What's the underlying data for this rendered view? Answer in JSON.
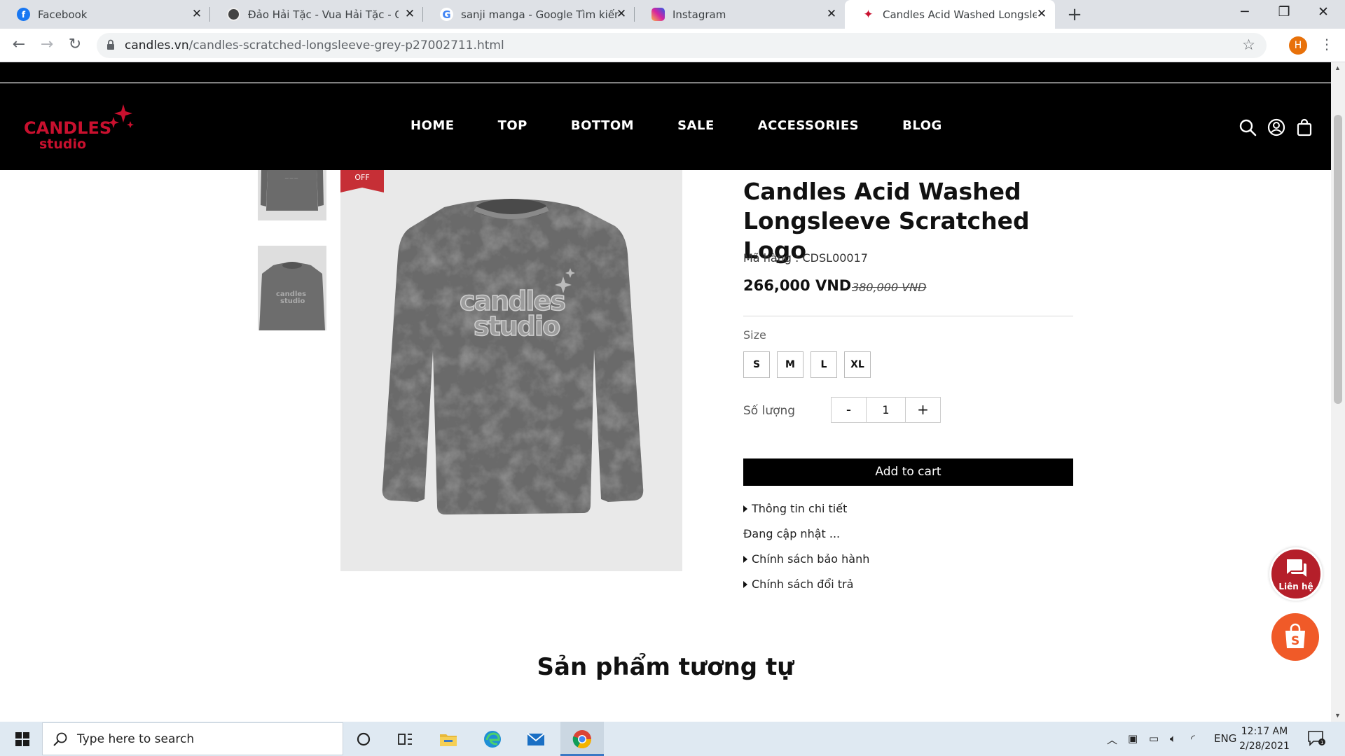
{
  "browser": {
    "tabs": [
      {
        "label": "Facebook",
        "icon": "facebook-icon",
        "color": "#1877f2",
        "glyph": "f"
      },
      {
        "label": "Đảo Hải Tặc - Vua Hải Tặc - One",
        "icon": "onepiece-favicon",
        "color": "#444444",
        "glyph": ""
      },
      {
        "label": "sanji manga - Google Tìm kiếm",
        "icon": "google-icon",
        "color": "#4285f4",
        "glyph": "G"
      },
      {
        "label": "Instagram",
        "icon": "instagram-icon",
        "color": "#d6249f",
        "glyph": ""
      },
      {
        "label": "Candles Acid Washed Longsleeve",
        "icon": "candles-favicon",
        "color": "#c8102e",
        "glyph": "✦"
      }
    ],
    "close_glyph": "✕",
    "new_tab_glyph": "+",
    "window_controls": {
      "minimize": "─",
      "restore": "❐",
      "close": "✕"
    },
    "url_host": "candles.vn",
    "url_path": "/candles-scratched-longsleeve-grey-p27002711.html",
    "profile_initial": "H"
  },
  "site": {
    "brand_line1": "CANDLES",
    "brand_line2": "studio",
    "brand_color": "#c8102e",
    "nav": [
      "HOME",
      "TOP",
      "BOTTOM",
      "SALE",
      "ACCESSORIES",
      "BLOG"
    ]
  },
  "product": {
    "badge": "OFF",
    "title": "Candles Acid Washed Longsleeve Scratched Logo",
    "sku": "Mã hàng : CDSL00017",
    "price": "266,000 VND",
    "old_price": "380,000 VND",
    "size_label": "Size",
    "sizes": [
      "S",
      "M",
      "L",
      "XL"
    ],
    "qty_label": "Số lượng",
    "qty_minus": "-",
    "qty_value": "1",
    "qty_plus": "+",
    "add_to_cart": "Add to cart",
    "details_label": "Thông tin chi tiết",
    "details_text": "Đang cập nhật ...",
    "warranty_label": "Chính sách bảo hành",
    "return_label": "Chính sách đổi trả",
    "print_text": "candles studio"
  },
  "related_heading": "Sản phẩm tương tự",
  "floating": {
    "contact_label": "Liên hệ"
  },
  "taskbar": {
    "search_placeholder": "Type here to search",
    "language": "ENG",
    "time": "12:17 AM",
    "date": "2/28/2021"
  }
}
